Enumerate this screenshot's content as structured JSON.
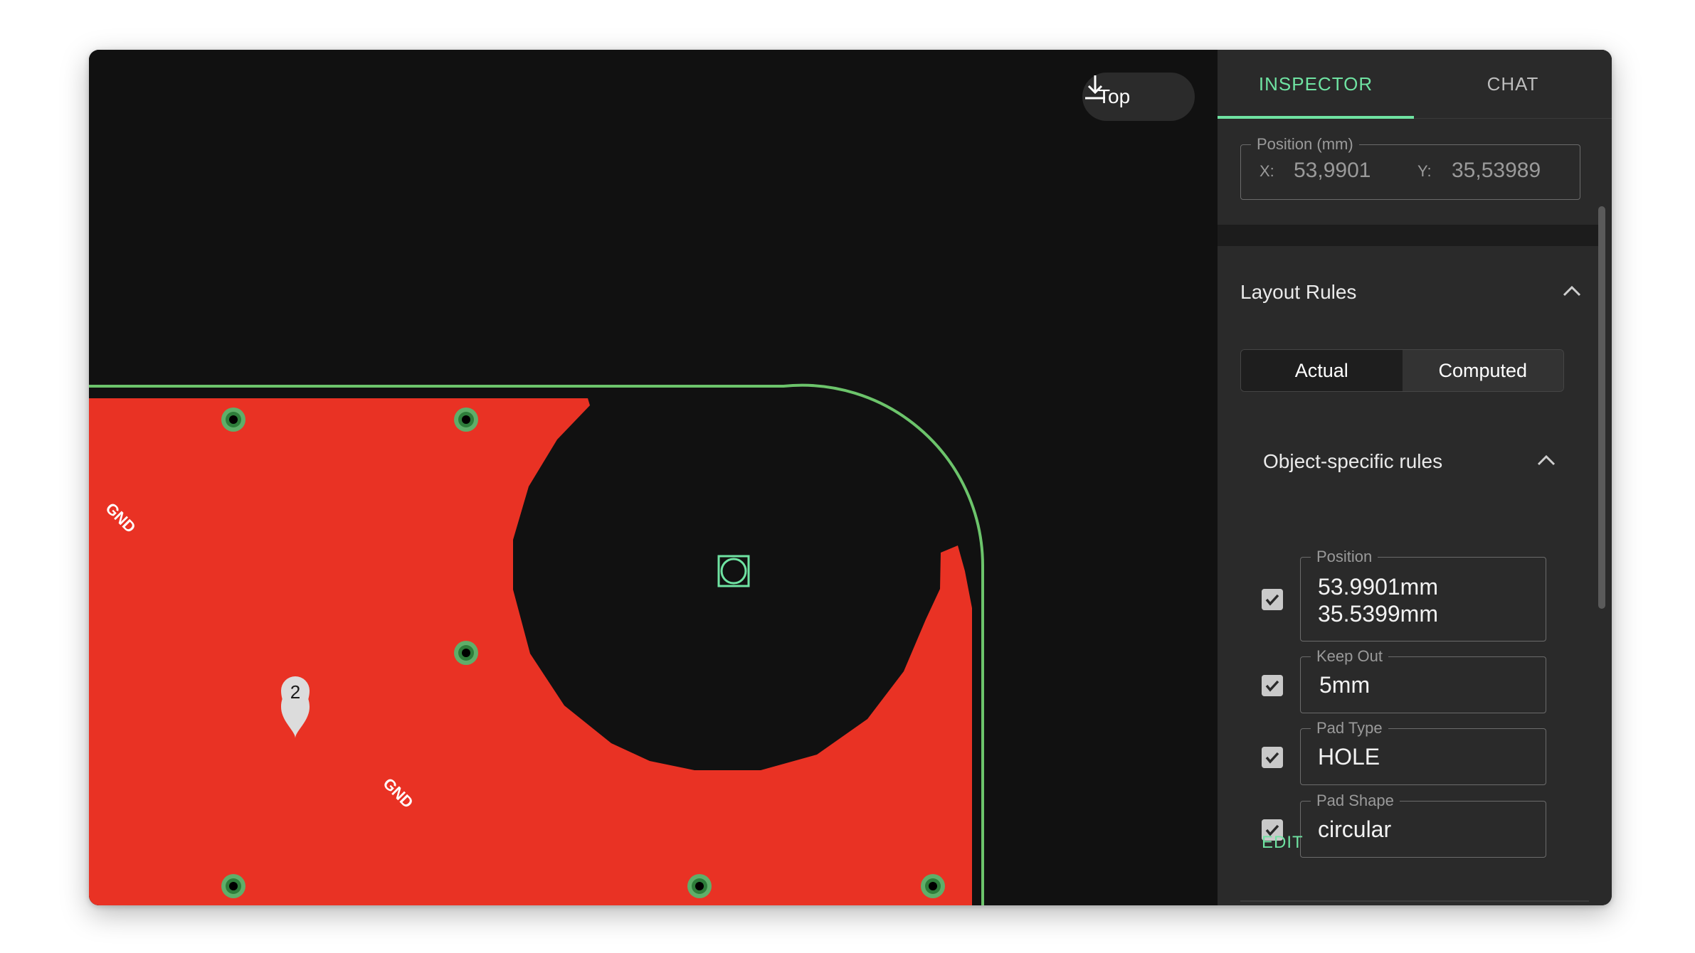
{
  "canvas": {
    "layer_button": {
      "label": "Top",
      "icon": "download-icon"
    },
    "labels": {
      "gnd_1": "GND",
      "gnd_2": "GND",
      "marker": "2"
    },
    "colors": {
      "copper": "#e93224",
      "board_outline": "#6cc46b",
      "background": "#111111",
      "via_ring": "#5fae69"
    }
  },
  "panel": {
    "tabs": [
      {
        "label": "INSPECTOR",
        "active": true
      },
      {
        "label": "CHAT",
        "active": false
      }
    ],
    "position": {
      "legend": "Position (mm)",
      "x_label": "X:",
      "x_value": "53,9901",
      "y_label": "Y:",
      "y_value": "35,53989"
    },
    "layout_rules": {
      "title": "Layout Rules",
      "segment": [
        {
          "label": "Actual",
          "selected": true
        },
        {
          "label": "Computed",
          "selected": false
        }
      ],
      "object_rules": {
        "title": "Object-specific rules",
        "rules": [
          {
            "legend": "Position",
            "value_line1": "53.9901mm",
            "value_line2": "35.5399mm",
            "checked": true
          },
          {
            "legend": "Keep Out",
            "value": "5mm",
            "checked": true
          },
          {
            "legend": "Pad Type",
            "value": "HOLE",
            "checked": true
          },
          {
            "legend": "Pad Shape",
            "value": "circular",
            "checked": true
          }
        ]
      },
      "edit_label": "EDIT"
    },
    "accent_color": "#6fe3a2"
  }
}
